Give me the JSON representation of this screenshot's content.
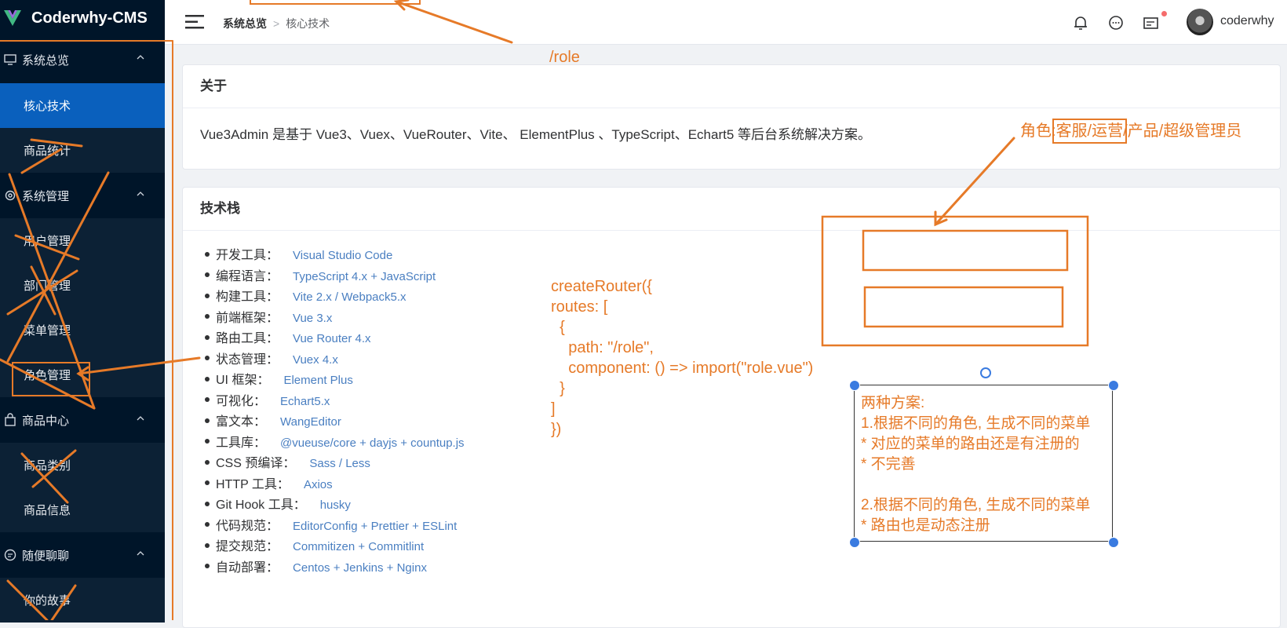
{
  "app": {
    "title": "Coderwhy-CMS"
  },
  "sidebar": {
    "groups": [
      {
        "label": "系统总览",
        "icon": "monitor-icon",
        "items": [
          "核心技术",
          "商品统计"
        ]
      },
      {
        "label": "系统管理",
        "icon": "gear-icon",
        "items": [
          "用户管理",
          "部门管理",
          "菜单管理",
          "角色管理"
        ]
      },
      {
        "label": "商品中心",
        "icon": "bag-icon",
        "items": [
          "商品类别",
          "商品信息"
        ]
      },
      {
        "label": "随便聊聊",
        "icon": "chat-icon",
        "items": [
          "你的故事"
        ]
      }
    ]
  },
  "header": {
    "breadcrumb": [
      "系统总览",
      "核心技术"
    ],
    "username": "coderwhy",
    "icons": [
      "bell-icon",
      "chat-bubble-icon",
      "message-card-icon"
    ]
  },
  "about": {
    "title": "关于",
    "text": "Vue3Admin 是基于 Vue3、Vuex、VueRouter、Vite、 ElementPlus 、TypeScript、Echart5 等后台系统解决方案。"
  },
  "tech": {
    "title": "技术栈",
    "items": [
      {
        "label": "开发工具：",
        "value": "Visual Studio Code"
      },
      {
        "label": "编程语言：",
        "value": "TypeScript 4.x + JavaScript"
      },
      {
        "label": "构建工具：",
        "value": "Vite 2.x / Webpack5.x"
      },
      {
        "label": "前端框架：",
        "value": "Vue 3.x"
      },
      {
        "label": "路由工具：",
        "value": "Vue Router 4.x"
      },
      {
        "label": "状态管理：",
        "value": "Vuex 4.x"
      },
      {
        "label": "UI 框架：",
        "value": "Element Plus"
      },
      {
        "label": "可视化：",
        "value": "Echart5.x"
      },
      {
        "label": "富文本：",
        "value": "WangEditor"
      },
      {
        "label": "工具库：",
        "value": "@vueuse/core + dayjs + countup.js"
      },
      {
        "label": "CSS 预编译：",
        "value": "Sass / Less"
      },
      {
        "label": "HTTP 工具：",
        "value": "Axios"
      },
      {
        "label": "Git Hook 工具：",
        "value": "husky"
      },
      {
        "label": "代码规范：",
        "value": "EditorConfig + Prettier + ESLint"
      },
      {
        "label": "提交规范：",
        "value": "Commitizen + Commitlint"
      },
      {
        "label": "自动部署：",
        "value": "Centos + Jenkins + Nginx"
      }
    ]
  },
  "annotations": {
    "role_path": "/role",
    "roles_prefix": "角色:",
    "roles_boxed": "客服/运营",
    "roles_rest": "/产品/超级管理员",
    "code": "createRouter({\nroutes: [\n  {\n    path: \"/role\",\n    component: () => import(\"role.vue\")\n  }\n]\n})",
    "plan": "两种方案:\n1.根据不同的角色, 生成不同的菜单\n* 对应的菜单的路由还是有注册的\n* 不完善\n\n2.根据不同的角色, 生成不同的菜单\n* 路由也是动态注册"
  },
  "colors": {
    "sidebar_bg": "#001529",
    "active_item": "#0a60bd",
    "annotation": "#e67a28",
    "link": "#4a7fc1"
  }
}
